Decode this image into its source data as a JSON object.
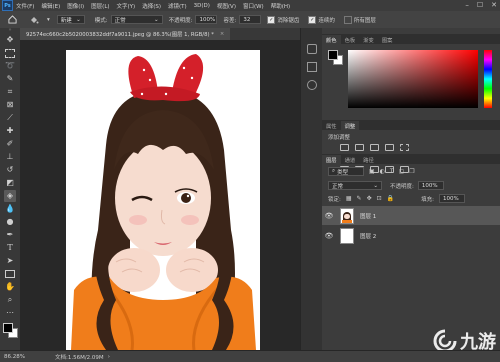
{
  "menubar": {
    "logo": "Ps",
    "items": [
      "文件(F)",
      "编辑(E)",
      "图像(I)",
      "图层(L)",
      "文字(Y)",
      "选择(S)",
      "滤镜(T)",
      "3D(D)",
      "视图(V)",
      "窗口(W)",
      "帮助(H)"
    ],
    "controls": [
      "–",
      "☐",
      "✕"
    ]
  },
  "options": {
    "new_label": "新建",
    "mode_label": "模式:",
    "mode_value": "正常",
    "opacity_label": "不透明度:",
    "opacity_value": "100%",
    "tolerance_label": "容差:",
    "tolerance_value": "32",
    "antialias_label": "消除锯齿",
    "contiguous_label": "连续的",
    "all_layers_label": "所有图层"
  },
  "document": {
    "tab_title": "92574ec660c2b5020003832ddf7a9011.jpeg @ 86.3%(图层 1, RGB/8) *",
    "close": "×"
  },
  "status": {
    "zoom": "86.28%",
    "doc_info": "文档:1.56M/2.09M"
  },
  "color_panel": {
    "tabs": [
      "颜色",
      "色板",
      "渐变",
      "图案"
    ],
    "fg": "#000000",
    "bg": "#ffffff",
    "accent_hue": "#ff0000"
  },
  "adjust_panel": {
    "tabs": [
      "属性",
      "调整"
    ],
    "title": "添加调整"
  },
  "layers_panel": {
    "tabs": [
      "图层",
      "通道",
      "路径"
    ],
    "filter_label": "类型",
    "blend_mode": "正常",
    "opacity_label": "不透明度:",
    "opacity_value": "100%",
    "lock_label": "锁定:",
    "fill_label": "填充:",
    "fill_value": "100%",
    "layers": [
      {
        "name": "图层 1",
        "selected": true
      },
      {
        "name": "图层 2",
        "selected": false
      }
    ]
  },
  "watermark": {
    "text": "九游"
  },
  "toolbar": {
    "tools": [
      "move-icon",
      "marquee-icon",
      "lasso-icon",
      "quick-select-icon",
      "crop-icon",
      "frame-icon",
      "eyedropper-icon",
      "healing-icon",
      "brush-icon",
      "stamp-icon",
      "history-brush-icon",
      "eraser-icon",
      "paint-bucket-icon",
      "blur-icon",
      "dodge-icon",
      "pen-icon",
      "type-icon",
      "path-select-icon",
      "rectangle-icon",
      "hand-icon",
      "zoom-icon",
      "more-icon"
    ]
  }
}
